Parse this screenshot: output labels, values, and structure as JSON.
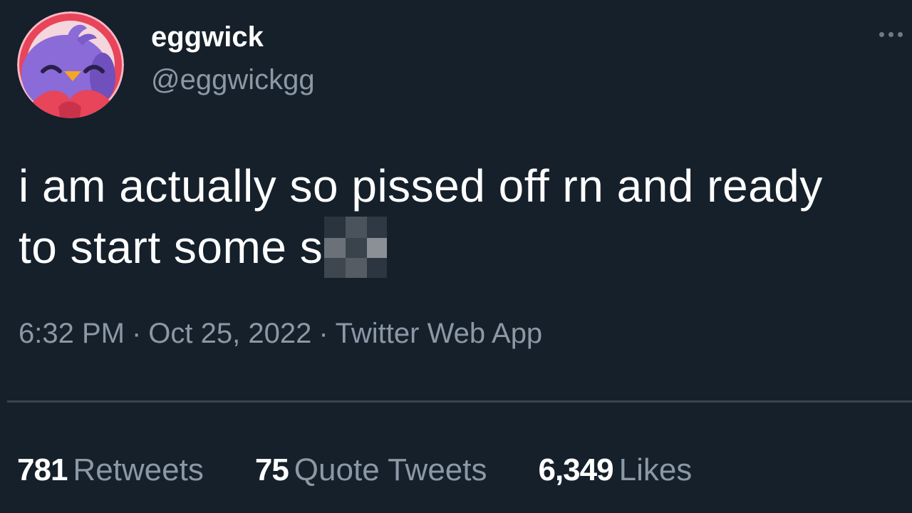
{
  "author": {
    "display_name": "eggwick",
    "handle": "@eggwickgg",
    "avatar_icon": "purple-bird-avatar-icon"
  },
  "tweet": {
    "line1": "i am actually so pissed off rn and ready",
    "line2_prefix": "to start some s",
    "time": "6:32 PM",
    "separator": "·",
    "date": "Oct 25, 2022",
    "source": "Twitter Web App"
  },
  "stats": {
    "retweets_count": "781",
    "retweets_label": "Retweets",
    "quotes_count": "75",
    "quotes_label": "Quote Tweets",
    "likes_count": "6,349",
    "likes_label": "Likes"
  },
  "colors": {
    "background": "#15202b",
    "text_primary": "#ffffff",
    "text_secondary": "#8b98a5",
    "divider": "#38444d",
    "avatar_ring": "#e8445a",
    "avatar_bird": "#8a6bd8"
  }
}
